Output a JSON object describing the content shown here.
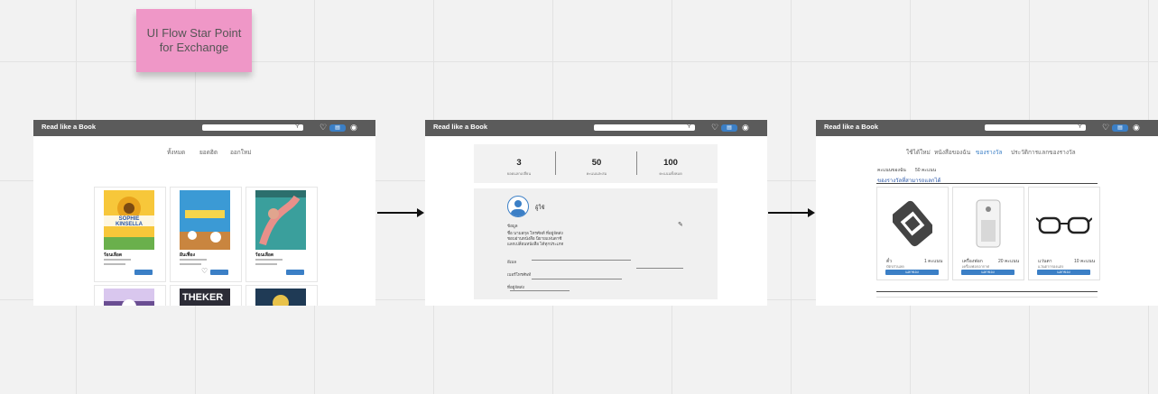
{
  "sticky_note": {
    "text": "UI Flow  Star Point\nfor Exchange"
  },
  "app": {
    "brand": "Read like a  Book"
  },
  "frame1": {
    "tabs": [
      "ทั้งหมด",
      "ยอดฮิต",
      "ออกใหม่"
    ],
    "books": [
      {
        "title": "ร้อนเลือด",
        "author": "SOPHIE KINSELLA"
      },
      {
        "title": "ฝันเฟื่อง",
        "author": ""
      },
      {
        "title": "ร้อนเลือด",
        "author": ""
      }
    ],
    "second_row_title": "THEKER"
  },
  "frame2": {
    "stats": [
      {
        "value": "3",
        "label": "ยอดแลกเปลี่ยน"
      },
      {
        "value": "50",
        "label": "คะแนนสะสม"
      },
      {
        "value": "100",
        "label": "คะแนนทั้งหมด"
      }
    ],
    "profile": {
      "name": "ผู้ใช้",
      "bio_label": "ข้อมูล",
      "bio_lines": [
        "ชื่อ นามสกุล โทรศัพท์ ที่อยู่จัดส่ง",
        "ชอบอ่านหนังสือ นิยายแฟนตาซี",
        "แลกเปลี่ยนหนังสือ ได้ทุกประเภท"
      ],
      "fields": [
        "อีเมล",
        "เบอร์โทรศัพท์",
        "ที่อยู่จัดส่ง"
      ]
    }
  },
  "frame3": {
    "tabs": [
      "ใช้ได้ใหม่",
      "หนังสือของฉัน",
      "ของรางวัล",
      "ประวัติการแลกของรางวัล"
    ],
    "points_label": "คะแนนของฉัน",
    "points_value": "50 คะแนน",
    "section_title": "ของรางวัลที่สามารถแลกได้",
    "products": [
      {
        "name": "ตั๋ว",
        "desc": "บัตรส่วนลด",
        "points": "1 คะแนน",
        "button": "แลกของ"
      },
      {
        "name": "เครื่องฟอก",
        "desc": "เครื่องฟอกอากาศ",
        "points": "20 คะแนน",
        "button": "แลกของ"
      },
      {
        "name": "แว่นตา",
        "desc": "แว่นตากรองแสง",
        "points": "10 คะแนน",
        "button": "แลกของ"
      }
    ]
  },
  "icons": [
    "heart-icon",
    "cart-icon",
    "user-icon",
    "search-icon",
    "edit-icon"
  ],
  "colors": {
    "accent": "#3b7fc6",
    "topbar": "#5b5b5b",
    "sticky": "#ef97c7"
  }
}
